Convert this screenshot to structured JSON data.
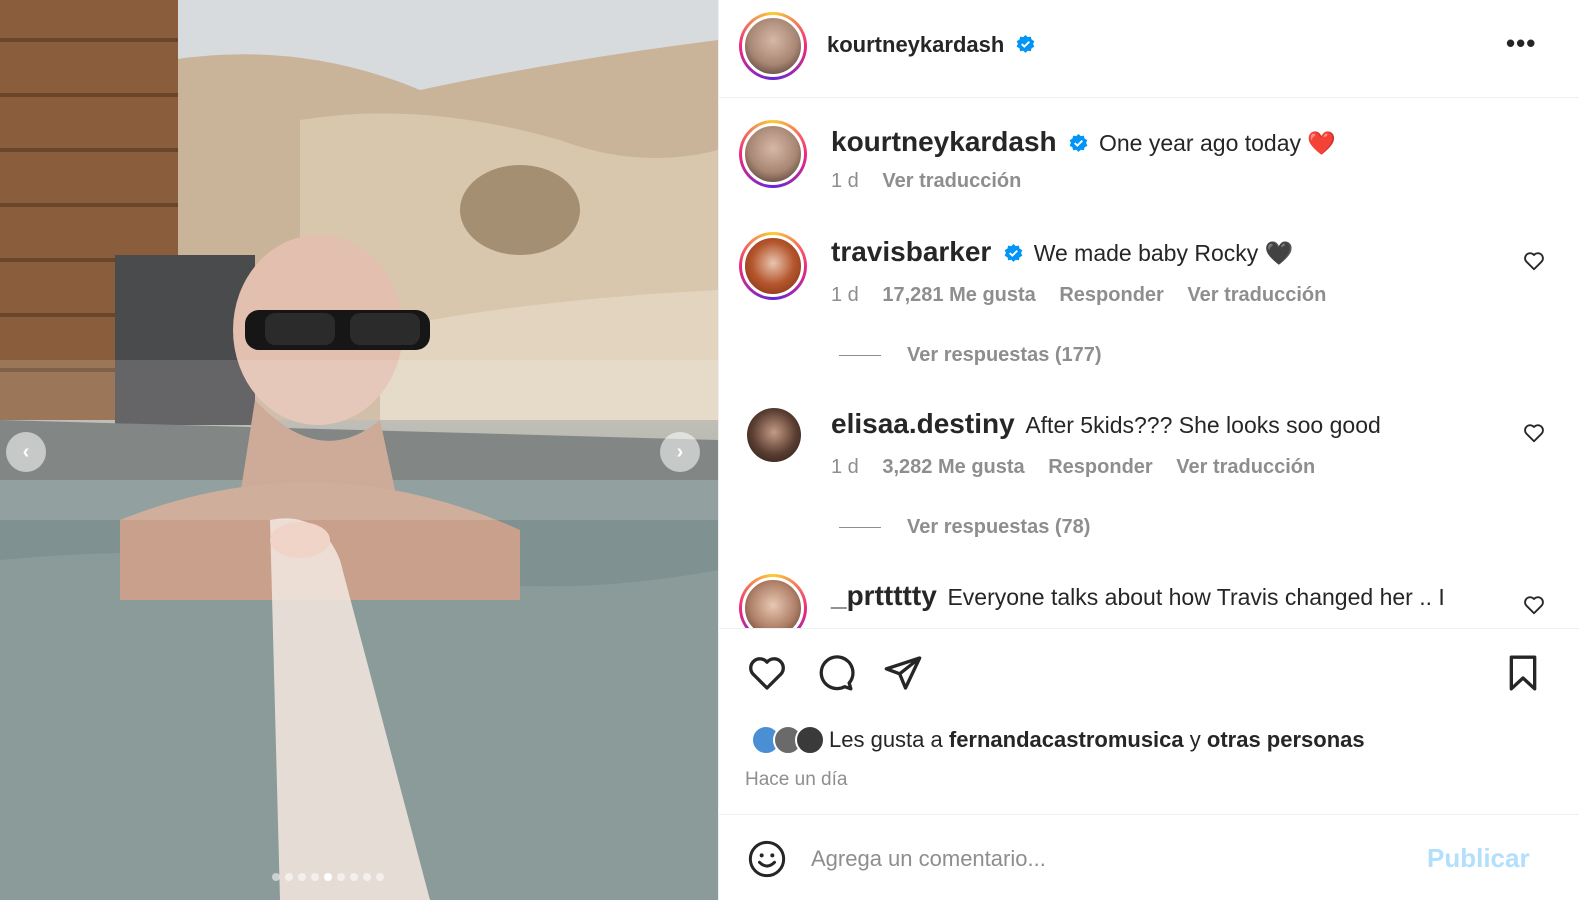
{
  "header": {
    "username": "kourtneykardash",
    "more_label": "•••"
  },
  "caption": {
    "username": "kourtneykardash",
    "text": "One year ago today ❤️",
    "time": "1 d",
    "translate": "Ver traducción"
  },
  "comments": [
    {
      "username": "travisbarker",
      "text": "We made baby Rocky 🖤",
      "time": "1 d",
      "likes": "17,281 Me gusta",
      "reply": "Responder",
      "translate": "Ver traducción",
      "replies": "Ver respuestas (177)"
    },
    {
      "username": "elisaa.destiny",
      "text": "After 5kids??? She looks soo good",
      "time": "1 d",
      "likes": "3,282 Me gusta",
      "reply": "Responder",
      "translate": "Ver traducción",
      "replies": "Ver respuestas (78)"
    },
    {
      "username": "_prttttty",
      "text": "Everyone talks about how Travis changed her .. I"
    }
  ],
  "likes_summary": {
    "prefix": "Les gusta a",
    "user": "fernandacastromusica",
    "connector": "y",
    "others": "otras personas"
  },
  "posted_ago": "Hace un día",
  "composer": {
    "placeholder": "Agrega un comentario...",
    "publish": "Publicar"
  },
  "carousel": {
    "prev": "‹",
    "next": "›",
    "total_slides": 9,
    "active_slide": 4
  },
  "colors": {
    "verified": "#0095f6",
    "publish_disabled": "#b2dffc",
    "muted_text": "#8e8e8e"
  }
}
